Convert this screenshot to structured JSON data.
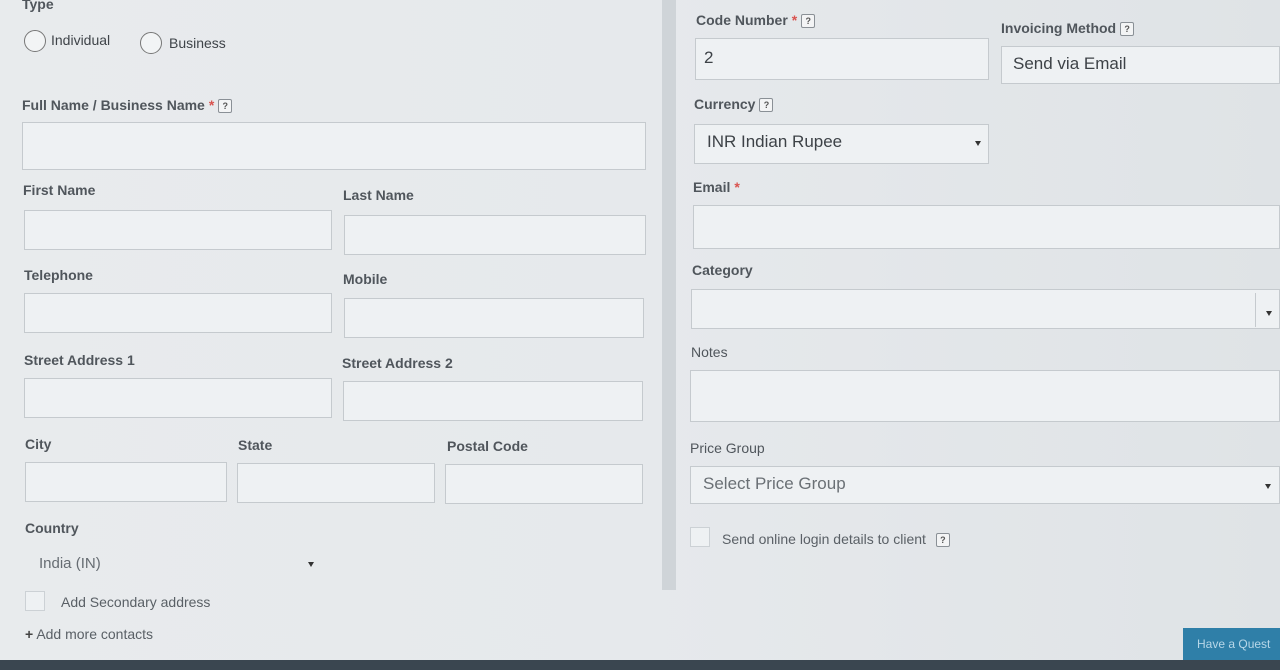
{
  "type_section": {
    "label": "Type",
    "options": [
      {
        "label": "Individual",
        "selected": false
      },
      {
        "label": "Business",
        "selected": false
      }
    ]
  },
  "full_name": {
    "label": "Full Name / Business Name",
    "required_mark": "*",
    "help": "?",
    "value": ""
  },
  "first_name": {
    "label": "First Name",
    "value": ""
  },
  "last_name": {
    "label": "Last Name",
    "value": ""
  },
  "telephone": {
    "label": "Telephone",
    "value": ""
  },
  "mobile": {
    "label": "Mobile",
    "value": ""
  },
  "street1": {
    "label": "Street Address 1",
    "value": ""
  },
  "street2": {
    "label": "Street Address 2",
    "value": ""
  },
  "city": {
    "label": "City",
    "value": ""
  },
  "state": {
    "label": "State",
    "value": ""
  },
  "postal": {
    "label": "Postal Code",
    "value": ""
  },
  "country": {
    "label": "Country",
    "value": "India (IN)"
  },
  "secondary_address": {
    "label": "Add Secondary address",
    "checked": false
  },
  "add_contacts": {
    "icon": "+",
    "label": "Add more contacts"
  },
  "code_number": {
    "label": "Code Number",
    "required_mark": "*",
    "help": "?",
    "value": "2"
  },
  "invoicing_method": {
    "label": "Invoicing Method",
    "help": "?",
    "value": "Send via Email"
  },
  "currency": {
    "label": "Currency",
    "help": "?",
    "value": "INR Indian Rupee"
  },
  "email": {
    "label": "Email",
    "required_mark": "*",
    "value": ""
  },
  "category": {
    "label": "Category",
    "value": ""
  },
  "notes": {
    "label": "Notes",
    "value": ""
  },
  "price_group": {
    "label": "Price Group",
    "placeholder": "Select Price Group"
  },
  "online_login": {
    "label": "Send online login details to client",
    "help": "?",
    "checked": false
  },
  "chat": {
    "label": "Have a Quest"
  },
  "colors": {
    "accent": "#2f7fa8",
    "required": "#d9534f"
  }
}
